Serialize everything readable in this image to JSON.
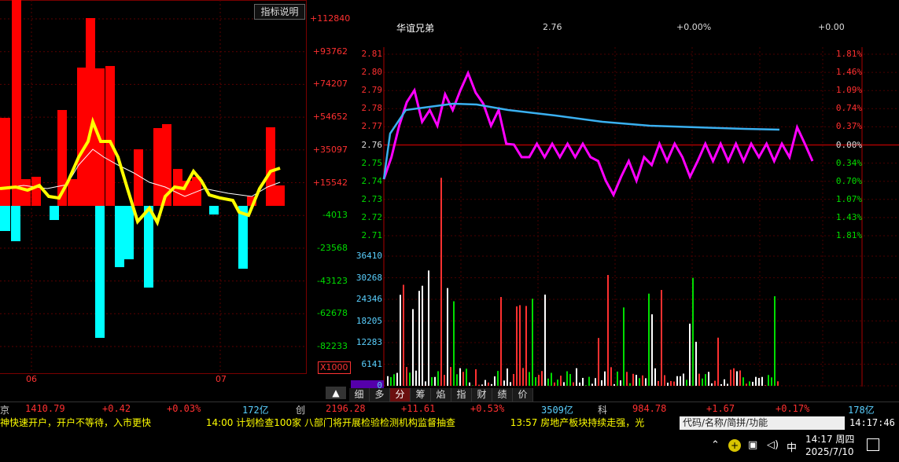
{
  "left_panel": {
    "indicator_button": "指标说明",
    "axis_labels": [
      "+112840",
      "+93762",
      "+74207",
      "+54652",
      "+35097",
      "+15542",
      "-4013",
      "-23568",
      "-43123",
      "-62678",
      "-82233"
    ],
    "scale_label": "X1000",
    "x_labels": [
      "06",
      "07"
    ]
  },
  "right_panel": {
    "stock_name": "华谊兄弟",
    "price": "2.76",
    "change_pct": "+0.00%",
    "change": "+0.00",
    "price_axis": [
      "2.81",
      "2.80",
      "2.79",
      "2.78",
      "2.77",
      "2.76",
      "2.75",
      "2.74",
      "2.73",
      "2.72",
      "2.71"
    ],
    "pct_axis": [
      "1.81%",
      "1.46%",
      "1.09%",
      "0.74%",
      "0.37%",
      "0.00%",
      "0.34%",
      "0.70%",
      "1.07%",
      "1.43%",
      "1.81%"
    ],
    "volume_axis": [
      "36410",
      "30268",
      "24346",
      "18205",
      "12283",
      "6141",
      "0"
    ]
  },
  "bottom_tabs": [
    "细",
    "多",
    "分",
    "筹",
    "焰",
    "指",
    "财",
    "绩",
    "价"
  ],
  "active_tab": "分",
  "index_bar": [
    {
      "name": "京",
      "value": "1410.79",
      "change": "+0.42",
      "pct": "+0.03%",
      "amount": "172亿"
    },
    {
      "name": "创",
      "value": "2196.28",
      "change": "+11.61",
      "pct": "+0.53%",
      "amount": "3509亿"
    },
    {
      "name": "科",
      "value": "984.78",
      "change": "+1.67",
      "pct": "+0.17%",
      "amount": "178亿"
    }
  ],
  "ticker": {
    "item1": "神快速开户，开户不等待，入市更快",
    "item2": "14:00 计划检查100家 八部门将开展检验检测机构监督抽查",
    "item3": "13:57 房地产板块持续走强，光"
  },
  "search": {
    "placeholder": "代码/名称/简拼/功能"
  },
  "clock": "14:17:46",
  "taskbar": {
    "time": "14:17 周四",
    "date": "2025/7/10",
    "ime": "中"
  },
  "colors": {
    "red": "#ff0000",
    "cyan": "#00ffff",
    "yellow": "#ffff00",
    "magenta": "#ff00ff",
    "avg_line": "#3ab0f0",
    "up": "#ff3030",
    "down": "#00dd00"
  }
}
